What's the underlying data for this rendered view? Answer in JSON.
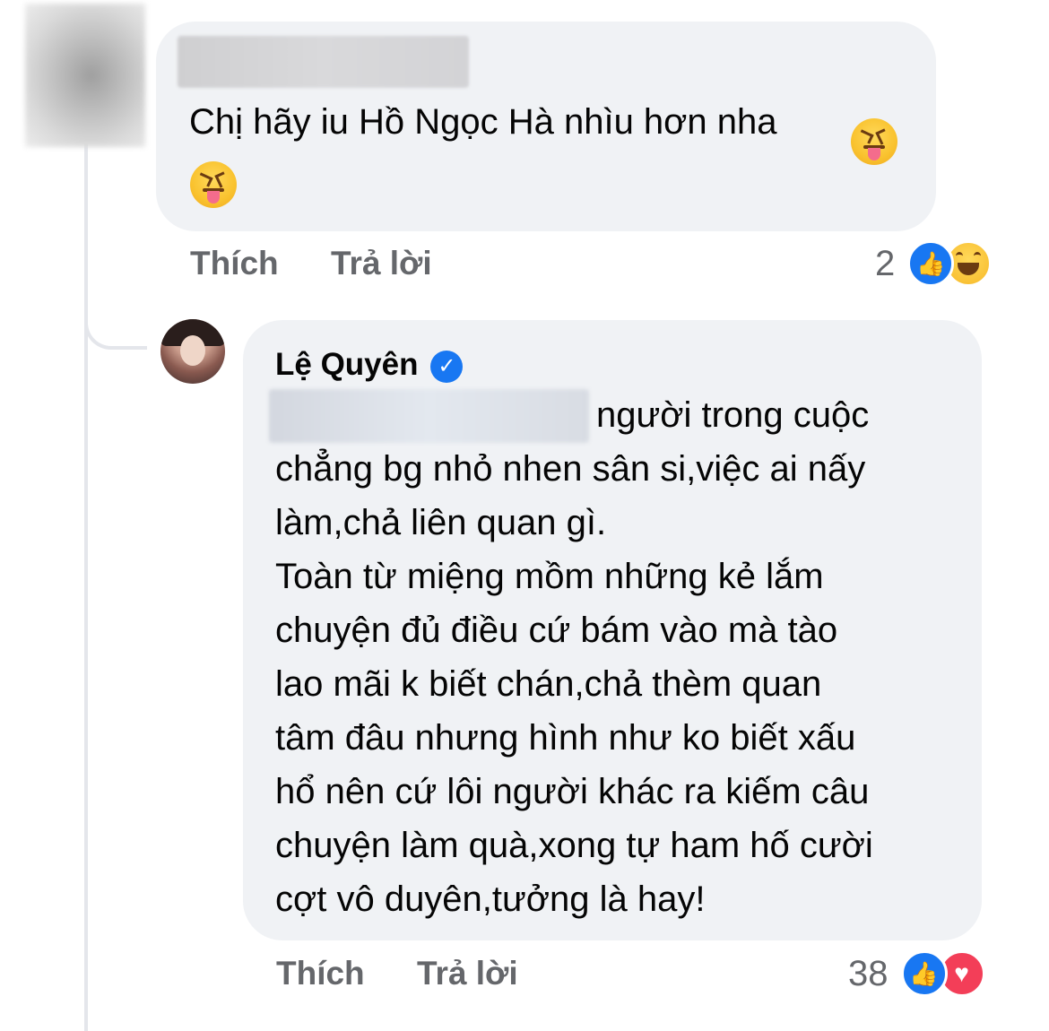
{
  "comments": [
    {
      "author": "",
      "text": "Chị hãy iu Hồ Ngọc Hà nhìu hơn nha",
      "actions": {
        "like": "Thích",
        "reply": "Trả lời"
      },
      "reactions": {
        "count": "2",
        "types": [
          "like-icon",
          "haha-icon"
        ]
      }
    },
    {
      "author": "Lệ Quyên",
      "verified": true,
      "text_first_line": "người trong cuộc",
      "text_rest": "chẳng bg nhỏ nhen sân si,việc ai nấy\nlàm,chả liên quan gì.\nToàn từ miệng mồm những kẻ lắm\nchuyện đủ điều cứ bám vào mà tào\nlao mãi k biết chán,chả thèm quan\ntâm đâu nhưng hình như ko biết xấu\nhổ nên cứ lôi người khác ra kiếm câu\nchuyện làm quà,xong tự ham hố cười\ncợt vô duyên,tưởng là hay!",
      "actions": {
        "like": "Thích",
        "reply": "Trả lời"
      },
      "reactions": {
        "count": "38",
        "types": [
          "like-icon",
          "love-icon"
        ]
      }
    }
  ],
  "colors": {
    "bubble": "#f0f2f5",
    "action_text": "#65676b",
    "like_blue": "#1877f2",
    "love_red": "#f33e58"
  }
}
